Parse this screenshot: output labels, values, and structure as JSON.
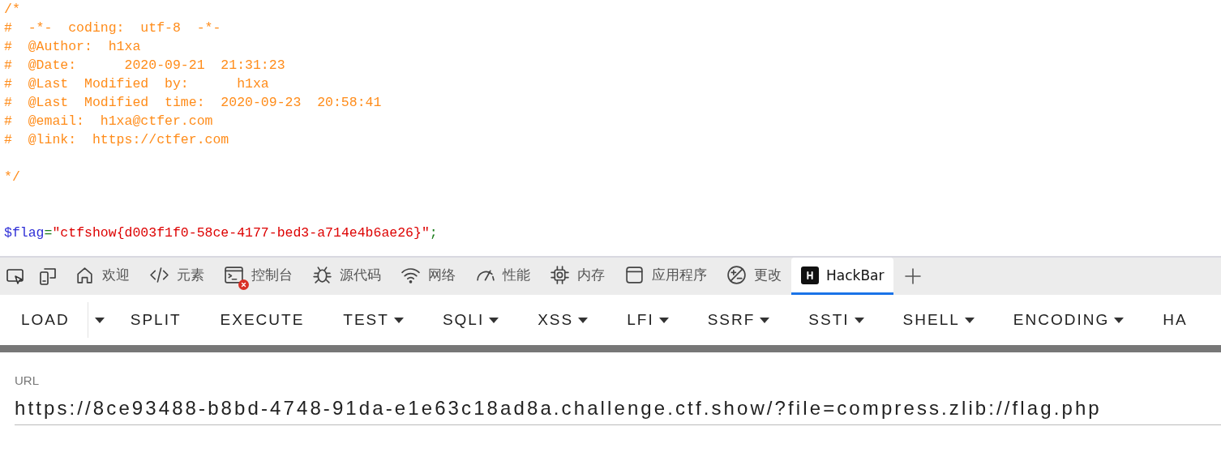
{
  "source": {
    "lines": [
      {
        "kind": "code",
        "segments": [
          {
            "kind": "comment",
            "text": "/*"
          }
        ]
      },
      {
        "kind": "code",
        "segments": [
          {
            "kind": "comment",
            "text": "#  -*-  coding:  utf-8  -*-"
          }
        ]
      },
      {
        "kind": "code",
        "segments": [
          {
            "kind": "comment",
            "text": "#  @Author:  h1xa"
          }
        ]
      },
      {
        "kind": "code",
        "segments": [
          {
            "kind": "comment",
            "text": "#  @Date:      2020-09-21  21:31:23"
          }
        ]
      },
      {
        "kind": "code",
        "segments": [
          {
            "kind": "comment",
            "text": "#  @Last  Modified  by:      h1xa"
          }
        ]
      },
      {
        "kind": "code",
        "segments": [
          {
            "kind": "comment",
            "text": "#  @Last  Modified  time:  2020-09-23  20:58:41"
          }
        ]
      },
      {
        "kind": "code",
        "segments": [
          {
            "kind": "comment",
            "text": "#  @email:  h1xa@ctfer.com"
          }
        ]
      },
      {
        "kind": "code",
        "segments": [
          {
            "kind": "comment",
            "text": "#  @link:  https://ctfer.com"
          }
        ]
      },
      {
        "kind": "blank"
      },
      {
        "kind": "code",
        "segments": [
          {
            "kind": "comment",
            "text": "*/"
          }
        ]
      },
      {
        "kind": "blank"
      },
      {
        "kind": "blank"
      },
      {
        "kind": "code",
        "segments": [
          {
            "kind": "variable",
            "text": "$flag"
          },
          {
            "kind": "operator",
            "text": "="
          },
          {
            "kind": "string",
            "text": "\"ctfshow{d003f1f0-58ce-4177-bed3-a714e4b6ae26}\""
          },
          {
            "kind": "punct",
            "text": ";"
          }
        ]
      }
    ]
  },
  "devtools": {
    "tabs": [
      {
        "label": "欢迎",
        "selected": false,
        "has_error": false
      },
      {
        "label": "元素",
        "selected": false,
        "has_error": false
      },
      {
        "label": "控制台",
        "selected": false,
        "has_error": true
      },
      {
        "label": "源代码",
        "selected": false,
        "has_error": false
      },
      {
        "label": "网络",
        "selected": false,
        "has_error": false
      },
      {
        "label": "性能",
        "selected": false,
        "has_error": false
      },
      {
        "label": "内存",
        "selected": false,
        "has_error": false
      },
      {
        "label": "应用程序",
        "selected": false,
        "has_error": false
      },
      {
        "label": "更改",
        "selected": false,
        "has_error": false
      },
      {
        "label": "HackBar",
        "selected": true,
        "has_error": false
      }
    ]
  },
  "hackbar": {
    "toolbar": [
      {
        "label": "LOAD",
        "kind": "split"
      },
      {
        "label": "SPLIT",
        "kind": "plain"
      },
      {
        "label": "EXECUTE",
        "kind": "plain"
      },
      {
        "label": "TEST",
        "kind": "menu"
      },
      {
        "label": "SQLI",
        "kind": "menu"
      },
      {
        "label": "XSS",
        "kind": "menu"
      },
      {
        "label": "LFI",
        "kind": "menu"
      },
      {
        "label": "SSRF",
        "kind": "menu"
      },
      {
        "label": "SSTI",
        "kind": "menu"
      },
      {
        "label": "SHELL",
        "kind": "menu"
      },
      {
        "label": "ENCODING",
        "kind": "menu"
      },
      {
        "label": "HA",
        "kind": "plain"
      }
    ],
    "url": {
      "label": "URL",
      "value": "https://8ce93488-b8bd-4748-91da-e1e63c18ad8a.challenge.ctf.show/?file=compress.zlib://flag.php"
    }
  }
}
